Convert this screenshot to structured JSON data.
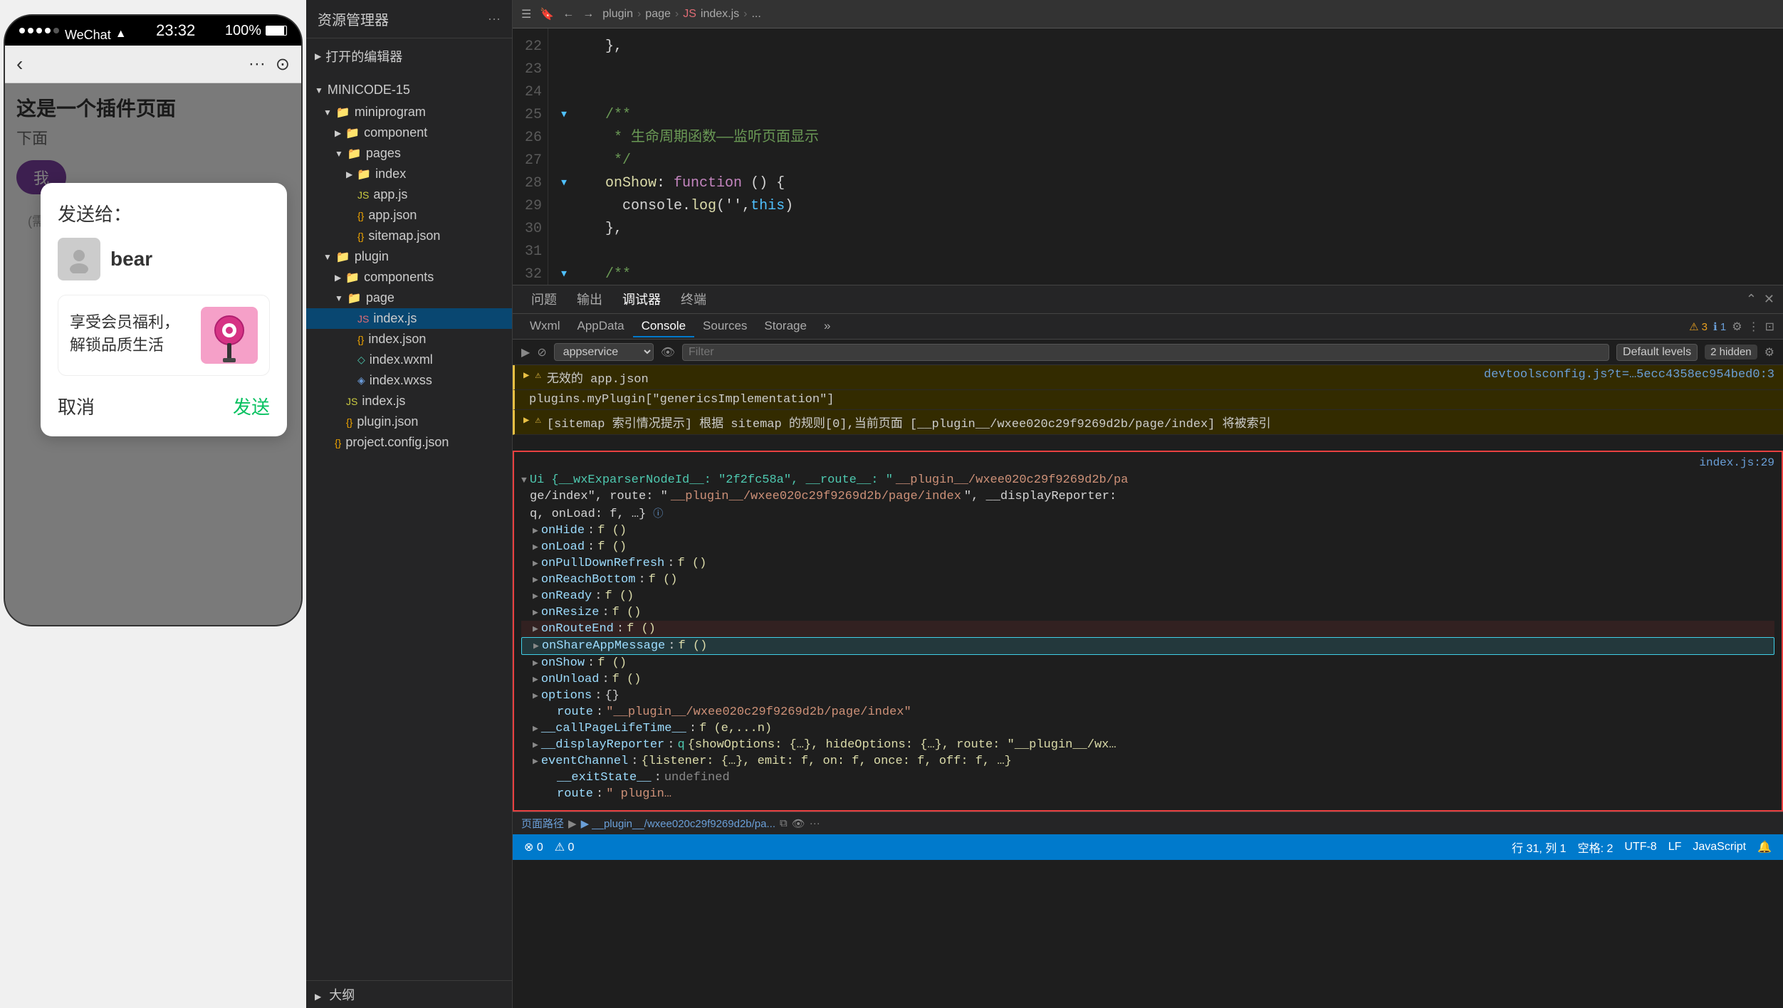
{
  "phone": {
    "status_bar": {
      "dots_label": "●●●●●",
      "wechat": "WeChat",
      "wifi": "WiFi",
      "time": "23:32",
      "battery": "100%"
    },
    "nav_bar": {
      "back_icon": "‹",
      "title": "",
      "menu_icon": "···",
      "camera_icon": "⊙"
    },
    "page": {
      "title": "这是一个插件页面",
      "subtitle": "下面",
      "btn_label": "我"
    },
    "note": "(需要",
    "share_dialog": {
      "title": "发送给：",
      "contact_name": "bear",
      "card_title": "享受会员福利，解锁品质生活",
      "cancel_label": "取消",
      "send_label": "发送"
    }
  },
  "file_explorer": {
    "header_title": "资源管理器",
    "header_dots": "···",
    "open_editors": "打开的编辑器",
    "project_name": "MINICODE-15",
    "tree": [
      {
        "id": "miniprogram",
        "label": "miniprogram",
        "type": "folder",
        "indent": 1,
        "expanded": true
      },
      {
        "id": "component",
        "label": "component",
        "type": "folder",
        "indent": 2,
        "expanded": false
      },
      {
        "id": "pages",
        "label": "pages",
        "type": "folder",
        "indent": 2,
        "expanded": true
      },
      {
        "id": "index-folder",
        "label": "index",
        "type": "folder",
        "indent": 3,
        "expanded": false
      },
      {
        "id": "app.js",
        "label": "app.js",
        "type": "js",
        "indent": 3
      },
      {
        "id": "app.json",
        "label": "app.json",
        "type": "json",
        "indent": 3
      },
      {
        "id": "sitemap.json",
        "label": "sitemap.json",
        "type": "json",
        "indent": 3
      },
      {
        "id": "plugin",
        "label": "plugin",
        "type": "folder",
        "indent": 1,
        "expanded": true
      },
      {
        "id": "components-folder",
        "label": "components",
        "type": "folder",
        "indent": 2,
        "expanded": false
      },
      {
        "id": "page-folder",
        "label": "page",
        "type": "folder",
        "indent": 2,
        "expanded": true
      },
      {
        "id": "index.js-active",
        "label": "index.js",
        "type": "js-active",
        "indent": 3,
        "active": true
      },
      {
        "id": "index.json",
        "label": "index.json",
        "type": "json",
        "indent": 3
      },
      {
        "id": "index.wxml",
        "label": "index.wxml",
        "type": "wxml",
        "indent": 3
      },
      {
        "id": "index.wxss",
        "label": "index.wxss",
        "type": "wxss",
        "indent": 3
      },
      {
        "id": "index.js-2",
        "label": "index.js",
        "type": "js",
        "indent": 2
      },
      {
        "id": "plugin.json",
        "label": "plugin.json",
        "type": "json",
        "indent": 2
      },
      {
        "id": "project.config.json",
        "label": "project.config.json",
        "type": "json",
        "indent": 1
      }
    ],
    "outline": "大纲"
  },
  "editor": {
    "breadcrumb": [
      "plugin",
      "page",
      "index.js",
      "..."
    ],
    "lines": {
      "start": 22,
      "items": [
        {
          "num": "22",
          "collapse": false,
          "code": "    },",
          "tokens": [
            {
              "text": "    },",
              "class": "kw-white"
            }
          ]
        },
        {
          "num": "23",
          "collapse": false,
          "code": "",
          "tokens": []
        },
        {
          "num": "24",
          "collapse": false,
          "code": "",
          "tokens": []
        },
        {
          "num": "25",
          "collapse": true,
          "code": "    /**",
          "tokens": [
            {
              "text": "    ",
              "class": "kw-white"
            },
            {
              "text": "/**",
              "class": "kw-green"
            }
          ]
        },
        {
          "num": "26",
          "collapse": false,
          "code": "     * 生命周期函数——监听页面显示",
          "tokens": [
            {
              "text": "     * 生命周期函数——监听页面显示",
              "class": "kw-green"
            }
          ]
        },
        {
          "num": "27",
          "collapse": false,
          "code": "     */",
          "tokens": [
            {
              "text": "     */",
              "class": "kw-green"
            }
          ]
        },
        {
          "num": "28",
          "collapse": true,
          "code": "    onShow: function () {",
          "tokens": [
            {
              "text": "    onShow",
              "class": "kw-yellow"
            },
            {
              "text": ": ",
              "class": "kw-white"
            },
            {
              "text": "function",
              "class": "kw-purple"
            },
            {
              "text": " () {",
              "class": "kw-white"
            }
          ]
        },
        {
          "num": "29",
          "collapse": false,
          "code": "      console.log('',this)",
          "tokens": [
            {
              "text": "      console.",
              "class": "kw-white"
            },
            {
              "text": "log",
              "class": "kw-yellow"
            },
            {
              "text": "('',",
              "class": "kw-white"
            },
            {
              "text": "this",
              "class": "kw-blue"
            },
            {
              "text": ")",
              "class": "kw-white"
            }
          ]
        },
        {
          "num": "30",
          "collapse": false,
          "code": "    },",
          "tokens": [
            {
              "text": "    },",
              "class": "kw-white"
            }
          ]
        },
        {
          "num": "31",
          "collapse": false,
          "code": "",
          "tokens": []
        },
        {
          "num": "32",
          "collapse": true,
          "code": "    /**",
          "tokens": [
            {
              "text": "    ",
              "class": "kw-white"
            },
            {
              "text": "/**",
              "class": "kw-green"
            }
          ]
        }
      ]
    }
  },
  "devtools": {
    "top_tabs": [
      "问题",
      "输出",
      "调试器",
      "终端"
    ],
    "active_top_tab": "调试器",
    "inner_tabs": [
      "Wxml",
      "AppData",
      "Console",
      "Sources",
      "Storage"
    ],
    "active_inner_tab": "Console",
    "toolbar": {
      "service": "appservice",
      "filter_placeholder": "Filter",
      "levels": "Default levels",
      "hidden_count": "2 hidden"
    },
    "console_lines": [
      {
        "type": "warning",
        "text": "无效的 app.json    devtoolsconfig.js?t=…5ecc4358ec954bed0:3",
        "link": "devtoolsconfig.js?t=…5ecc4358ec954bed0:3"
      },
      {
        "type": "warning",
        "text": "plugins.myPlugin[\"genericsImplementation\"]"
      },
      {
        "type": "warning",
        "text": "[sitemap 索引情况提示] 根据 sitemap 的规则[0],当前页面 [__plugin__/wxee020c29f9269d2b/page/index] 将被索引"
      }
    ],
    "object_header": "index.js:29",
    "object_path": "Ui {__wxExparserNodeId__: \"2f2fc58a\", __route__: \"__plugin__/wxee020c29f9269d2b/page/index\", route: \"__plugin__/wxee020c29f9269d2b/page/index\", __displayReporter: q, onLoad: f, …}",
    "object_fields": [
      {
        "key": "onHide",
        "value": "f ()",
        "indent": 1
      },
      {
        "key": "onLoad",
        "value": "f ()",
        "indent": 1
      },
      {
        "key": "onPullDownRefresh",
        "value": "f ()",
        "indent": 1
      },
      {
        "key": "onReachBottom",
        "value": "f ()",
        "indent": 1
      },
      {
        "key": "onReady",
        "value": "f ()",
        "indent": 1
      },
      {
        "key": "onResize",
        "value": "f ()",
        "indent": 1
      },
      {
        "key": "onRouteEnd",
        "value": "f ()",
        "indent": 1,
        "highlighted": true
      },
      {
        "key": "onShareAppMessage",
        "value": "f ()",
        "indent": 1,
        "cyan_highlight": true
      },
      {
        "key": "onShow",
        "value": "f ()",
        "indent": 1
      },
      {
        "key": "onUnload",
        "value": "f ()",
        "indent": 1
      },
      {
        "key": "options",
        "value": "{}",
        "indent": 1
      },
      {
        "key": "route",
        "value": "\"__plugin__/wxee020c29f9269d2b/page/index\"",
        "indent": 2
      },
      {
        "key": "__callPageLifeTime__",
        "value": "f (e,...n)",
        "indent": 1
      },
      {
        "key": "__displayReporter",
        "value": "q {showOptions: {…}, hideOptions: {…}, route: \"__plugin__/wx…",
        "indent": 1
      },
      {
        "key": "eventChannel",
        "value": "{listener: {…}, emit: f, on: f, once: f, off: f, …}",
        "indent": 1
      },
      {
        "key": "__exitState__",
        "value": "undefined",
        "indent": 2
      },
      {
        "key": "route",
        "value": "\" plugin…",
        "indent": 2
      }
    ]
  },
  "status_bar": {
    "path": "页面路径",
    "path_value": "▶ __plugin__/wxee020c29f9269d2b/pa...",
    "copy_icon": "⧉",
    "eye_icon": "👁",
    "dots_icon": "···",
    "errors": "⊗ 0",
    "warnings": "⚠ 0",
    "position": "行 31, 列 1",
    "spaces": "空格: 2",
    "encoding": "UTF-8",
    "line_ending": "LF",
    "language": "JavaScript",
    "bell_icon": "🔔"
  }
}
